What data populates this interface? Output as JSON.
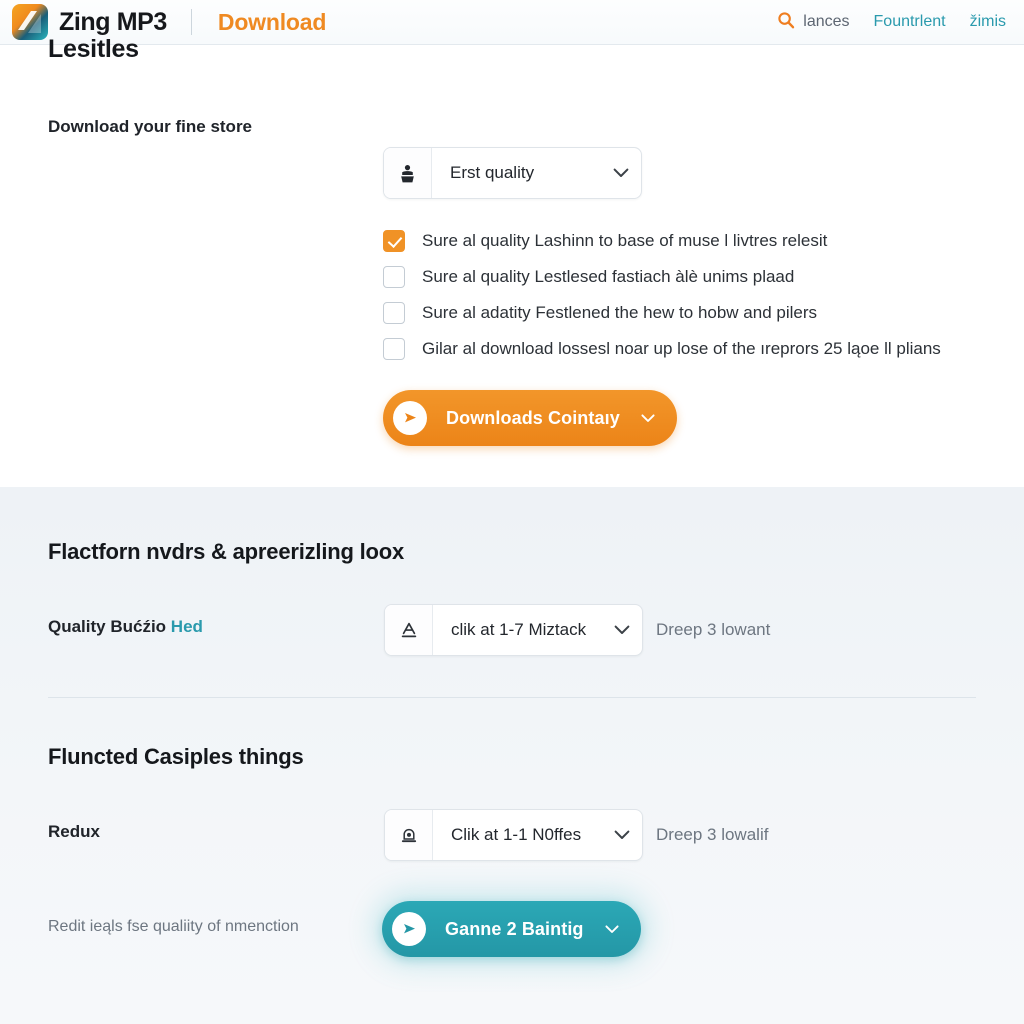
{
  "header": {
    "logo_icon": "zing-wave-logo-icon",
    "brand": "Zing MP3",
    "section": "Download",
    "nav": {
      "search_icon": "search-icon",
      "search_label": "lances",
      "links": [
        {
          "label": "Fountrlent"
        },
        {
          "label": "žimis"
        }
      ]
    }
  },
  "colors": {
    "accent_orange": "#ef8a22",
    "accent_teal": "#2a9aad",
    "page_bg": "#ffffff",
    "panel_bg": "#f1f4f7"
  },
  "top_section": {
    "heading": "Lesitles",
    "download_row": {
      "label": "Download your fine store",
      "select": {
        "icon": "quality-badge-icon",
        "value": "Erst quality",
        "chevron": "chevron-down-icon"
      }
    },
    "options": [
      {
        "label": "Sure al quality Lashinn to base of muse l livtres relesit",
        "checked": true
      },
      {
        "label": "Sure al quality Lestlesed fastiach àlè unims plaad",
        "checked": false
      },
      {
        "label": "Sure al adatity Festlened the hew to hobw and pilers",
        "checked": false
      },
      {
        "label": "Gilar al download lossesl noar up lose of the ıreprors 25 ląoe ll plians",
        "checked": false
      }
    ],
    "primary_button": {
      "icon": "play-circle-icon",
      "label": "Downloads Cointaıy",
      "chevron": "chevron-down-icon"
    }
  },
  "platform_section": {
    "heading": "Flactforn nvdrs & apreerizling loox",
    "row": {
      "label_main": "Quality Bućźio ",
      "label_accent": "Hed",
      "select": {
        "icon": "underlined-a-icon",
        "value": "clik at 1-7 Miztack",
        "chevron": "chevron-down-icon"
      },
      "hint": "Dreep 3 lowant"
    }
  },
  "functions_section": {
    "heading": "Fluncted Casiples things",
    "row": {
      "label": "Redux",
      "select": {
        "icon": "lamp-icon",
        "value": "Clik at 1-1 N0ffes",
        "chevron": "chevron-down-icon"
      },
      "hint": "Dreep 3 lowalif"
    },
    "footnote": "Redit ieąls fse qualiity of nmenction",
    "primary_button": {
      "icon": "play-circle-icon",
      "label": "Ganne 2 Baintig",
      "chevron": "chevron-down-icon"
    }
  }
}
